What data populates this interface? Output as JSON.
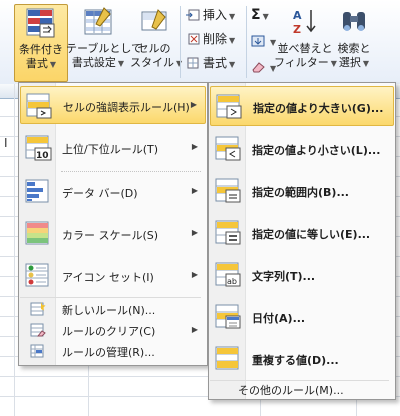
{
  "ribbon": {
    "cond_format": {
      "line1": "条件付き",
      "line2": "書式",
      "arrow": "▼"
    },
    "table_format": {
      "line1": "テーブルとして",
      "line2": "書式設定",
      "arrow": "▼"
    },
    "cell_style": {
      "line1": "セルの",
      "line2": "スタイル",
      "arrow": "▼"
    },
    "insert_label": "挿入",
    "delete_label": "削除",
    "format_label": "書式",
    "sigma": "Σ",
    "sort_filter": {
      "line1": "並べ替えと",
      "line2": "フィルター",
      "arrow": "▼"
    },
    "find_select": {
      "line1": "検索と",
      "line2": "選択",
      "arrow": "▼"
    }
  },
  "sheet": {
    "cursor_text": "I"
  },
  "main_menu": {
    "items": [
      {
        "label": "セルの強調表示ルール(H)",
        "icon": "highlight-rules-icon",
        "submenu": true,
        "highlighted": true
      },
      {
        "label": "上位/下位ルール(T)",
        "icon": "top-bottom-rules-icon",
        "submenu": true
      },
      {
        "label": "データ バー(D)",
        "icon": "data-bars-icon",
        "submenu": true
      },
      {
        "label": "カラー スケール(S)",
        "icon": "color-scales-icon",
        "submenu": true
      },
      {
        "label": "アイコン セット(I)",
        "icon": "icon-sets-icon",
        "submenu": true
      }
    ],
    "small_items": [
      {
        "label": "新しいルール(N)...",
        "icon": "new-rule-icon"
      },
      {
        "label": "ルールのクリア(C)",
        "icon": "clear-rules-icon",
        "submenu": true
      },
      {
        "label": "ルールの管理(R)...",
        "icon": "manage-rules-icon"
      }
    ]
  },
  "sub_menu": {
    "items": [
      {
        "label": "指定の値より大きい(G)...",
        "icon": "greater-than-icon",
        "highlighted": true
      },
      {
        "label": "指定の値より小さい(L)...",
        "icon": "less-than-icon"
      },
      {
        "label": "指定の範囲内(B)...",
        "icon": "between-icon"
      },
      {
        "label": "指定の値に等しい(E)...",
        "icon": "equal-to-icon"
      },
      {
        "label": "文字列(T)...",
        "icon": "text-contains-icon"
      },
      {
        "label": "日付(A)...",
        "icon": "date-occurring-icon"
      },
      {
        "label": "重複する値(D)...",
        "icon": "duplicate-values-icon"
      }
    ],
    "more_rules": "その他のルール(M)..."
  },
  "colors": {
    "highlight": "#fbd86c",
    "accent_blue": "#2b579a",
    "border": "#979797"
  }
}
